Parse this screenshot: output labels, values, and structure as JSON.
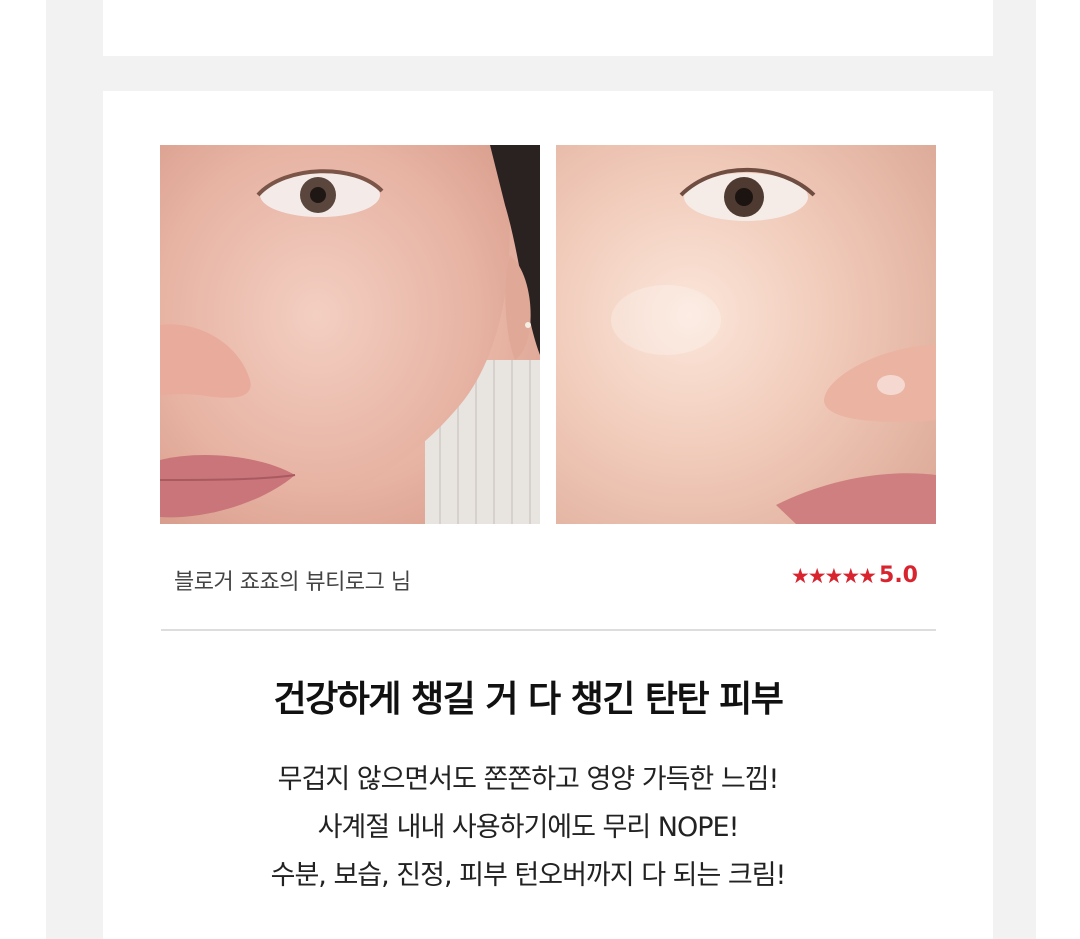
{
  "review": {
    "photos": [
      {
        "name": "face-photo-before",
        "description": "close-up of face, left cheek"
      },
      {
        "name": "face-photo-after",
        "description": "close-up of face, right cheek"
      }
    ],
    "reviewer": "블로거 죠죠의 뷰티로그 님",
    "rating_stars": "★★★★★",
    "rating_value": "5.0",
    "headline": "건강하게 챙길 거 다 챙긴 탄탄 피부",
    "body_lines": [
      "무겁지 않으면서도 쫀쫀하고 영양 가득한 느낌!",
      "사계절 내내 사용하기에도 무리 NOPE!",
      "수분, 보습, 진정, 피부 턴오버까지 다 되는 크림!"
    ]
  },
  "colors": {
    "page_bg": "#f2f2f2",
    "card_bg": "#ffffff",
    "rating": "#d8242f",
    "divider": "#dddddd"
  }
}
